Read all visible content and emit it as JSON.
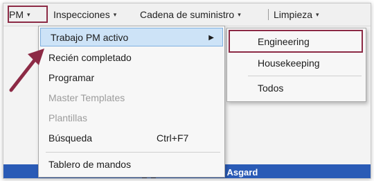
{
  "menubar": {
    "items": [
      {
        "label": "PM",
        "caret": "▾"
      },
      {
        "label": "Inspecciones",
        "caret": "▾"
      },
      {
        "label": "Cadena de suministro",
        "caret": "▾"
      },
      {
        "label": "Limpieza",
        "caret": "▾"
      }
    ]
  },
  "pm_menu": {
    "items": [
      {
        "label": "Trabajo PM activo",
        "state": "active",
        "submenu_arrow": "▶"
      },
      {
        "label": "Recién completado",
        "state": "enabled"
      },
      {
        "label": "Programar",
        "state": "enabled"
      },
      {
        "label": "Master Templates",
        "state": "disabled"
      },
      {
        "label": "Plantillas",
        "state": "disabled"
      },
      {
        "label": "Búsqueda",
        "state": "enabled",
        "shortcut": "Ctrl+F7"
      },
      {
        "label": "Tablero de mandos",
        "state": "enabled"
      }
    ]
  },
  "submenu": {
    "items": [
      {
        "label": "Engineering"
      },
      {
        "label": "Housekeeping"
      },
      {
        "label": "Todos"
      }
    ]
  },
  "background": {
    "band_text": "Noticias de Asgard"
  },
  "colors": {
    "annotation": "#8c2a45",
    "menu_active_bg": "#cde3f7",
    "menu_active_border": "#7fb0e0",
    "band_blue": "#2a5bb6"
  }
}
